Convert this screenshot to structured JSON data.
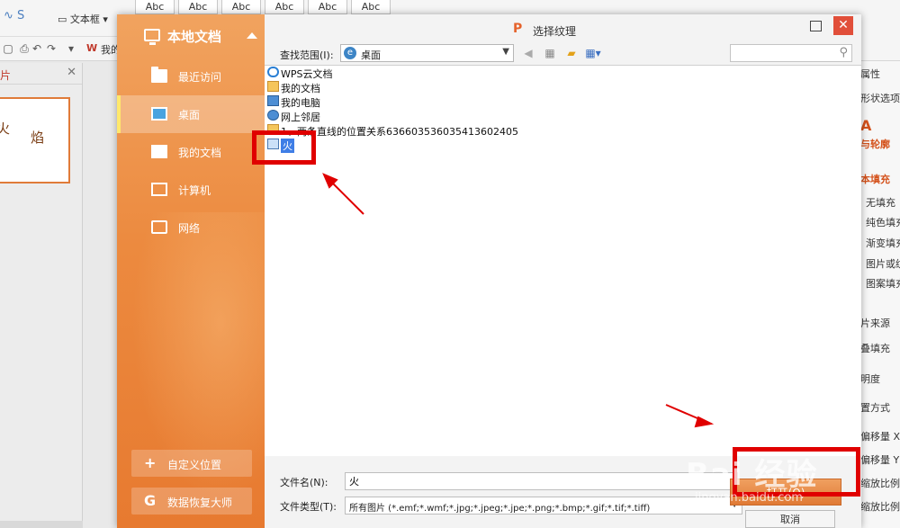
{
  "ribbon": {
    "style_samples": [
      "Abc",
      "Abc",
      "Abc",
      "Abc",
      "Abc",
      "Abc"
    ],
    "textbox_label": "文本框",
    "wps_label": "我的"
  },
  "left_pane": {
    "header_label": "片",
    "slide_text": [
      "火",
      "焰"
    ]
  },
  "right_pane": {
    "items": [
      "属性",
      "形状选项",
      "A",
      "与轮廓",
      "本填充",
      "无填充",
      "纯色填充",
      "渐变填充",
      "图片或纹",
      "图案填充",
      "片来源",
      "叠填充",
      "明度",
      "置方式",
      "偏移量 X",
      "偏移量 Y",
      "缩放比例",
      "缩放比例"
    ]
  },
  "dialog": {
    "logo": "P",
    "title": "选择纹理",
    "sidebar": {
      "header": "本地文档",
      "items": [
        {
          "label": "最近访问",
          "icon": "clock-folder-icon"
        },
        {
          "label": "桌面",
          "icon": "desktop-icon"
        },
        {
          "label": "我的文档",
          "icon": "documents-folder-icon"
        },
        {
          "label": "计算机",
          "icon": "computer-icon"
        },
        {
          "label": "网络",
          "icon": "network-icon"
        }
      ],
      "custom_location": "自定义位置",
      "data_recovery": "数据恢复大师"
    },
    "lookin": {
      "label": "查找范围(I):",
      "value": "桌面"
    },
    "files": [
      {
        "name": "WPS云文档",
        "icon": "cloud-icon"
      },
      {
        "name": "我的文档",
        "icon": "documents-icon"
      },
      {
        "name": "我的电脑",
        "icon": "computer-icon"
      },
      {
        "name": "网上邻居",
        "icon": "network-icon"
      },
      {
        "name": "1、两条直线的位置关系6366035360354136024​05",
        "icon": "folder-icon"
      },
      {
        "name": "火",
        "icon": "image-icon",
        "selected": true
      }
    ],
    "filename": {
      "label": "文件名(N):",
      "value": "火"
    },
    "filetype": {
      "label": "文件类型(T):",
      "value": "所有图片 (*.emf;*.wmf;*.jpg;*.jpeg;*.jpe;*.png;*.bmp;*.gif;*.tif;*.tiff)"
    },
    "open_label": "打开(O)",
    "cancel_label": "取消"
  },
  "watermark": {
    "big": "Bai 经验",
    "small": "jingyan.baidu.com"
  },
  "colors": {
    "sidebar_orange": "#ec8a3f",
    "annotation_red": "#e00000",
    "selection_blue": "#3f7ee6",
    "close_red": "#e14f3a"
  }
}
